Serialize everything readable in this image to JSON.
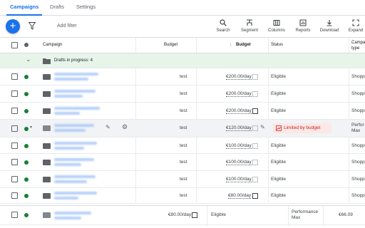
{
  "tabs": [
    {
      "label": "Campaigns",
      "active": true
    },
    {
      "label": "Drafts",
      "active": false
    },
    {
      "label": "Settings",
      "active": false
    }
  ],
  "toolbar": {
    "add_label": "+",
    "add_filter": "Add filter",
    "tools": [
      "Search",
      "Segment",
      "Columns",
      "Reports",
      "Download",
      "Expand"
    ]
  },
  "table": {
    "headers": {
      "campaign": "Campaign",
      "budget1": "Budget",
      "budget2": "Budget",
      "status": "Status",
      "type": "Campai type"
    },
    "drafts_label": "Drafts in progress: 4",
    "rows": [
      {
        "label": "test",
        "budget": "€200.00/day",
        "status": "Eligible",
        "type": "Shoppi"
      },
      {
        "label": "test",
        "budget": "€200.00/day",
        "status": "Eligible",
        "type": "Shoppi"
      },
      {
        "label": "test",
        "budget": "€200.00/day",
        "status": "Eligible",
        "type": "Shoppi"
      },
      {
        "label": "test",
        "budget": "€120.00/day",
        "status": "Limited by budget",
        "type": "Perfor Max"
      },
      {
        "label": "test",
        "budget": "€100.00/day",
        "status": "Eligible",
        "type": "Shoppi"
      },
      {
        "label": "test",
        "budget": "€100.00/day",
        "status": "Eligible",
        "type": "Shoppi"
      },
      {
        "label": "test",
        "budget": "€100.00/day",
        "status": "Eligible",
        "type": "Shoppi"
      },
      {
        "label": "test",
        "budget": "€80.00/day",
        "status": "Eligible",
        "type": "Shoppi"
      }
    ],
    "footer_row": {
      "budget": "€80.00/day",
      "status": "Eligible",
      "type": "Performance Max",
      "cost": "€66.09"
    }
  },
  "colors": {
    "accent": "#1a73e8",
    "enabled": "#188038",
    "limited_bg": "#fce8e6",
    "limited_text": "#c5221f",
    "drafts_bg": "#e6f4ea"
  }
}
